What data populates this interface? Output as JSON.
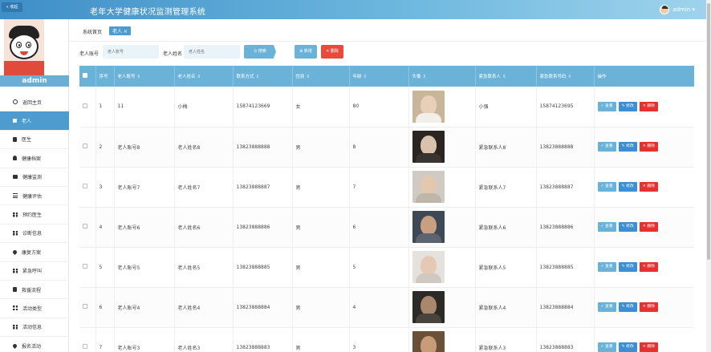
{
  "header": {
    "collapse_label": "« 收起",
    "title": "老年大学健康状况监测管理系统",
    "user": "admin ▾"
  },
  "sidebar": {
    "username": "admin",
    "items": [
      {
        "label": "返回主页",
        "icon": "home-icon"
      },
      {
        "label": "老人",
        "icon": "square-icon",
        "active": true
      },
      {
        "label": "医生",
        "icon": "doc-icon"
      },
      {
        "label": "健康档案",
        "icon": "person-icon"
      },
      {
        "label": "健康监测",
        "icon": "briefcase-icon"
      },
      {
        "label": "健康评估",
        "icon": "list-icon"
      },
      {
        "label": "预约医生",
        "icon": "grid-icon"
      },
      {
        "label": "诊断信息",
        "icon": "grid-icon"
      },
      {
        "label": "康复方案",
        "icon": "pin-icon"
      },
      {
        "label": "紧急呼叫",
        "icon": "grid-icon"
      },
      {
        "label": "救援流程",
        "icon": "doc-icon"
      },
      {
        "label": "活动类型",
        "icon": "grid-icon"
      },
      {
        "label": "活动信息",
        "icon": "grid-icon"
      },
      {
        "label": "报名活动",
        "icon": "pin-icon"
      }
    ]
  },
  "breadcrumb": {
    "home": "系统首页",
    "tag": "老人 ×"
  },
  "search": {
    "account_label": "老人账号",
    "account_placeholder": "老人账号",
    "name_label": "老人姓名",
    "name_placeholder": "老人姓名",
    "search_btn": "⊙ 搜索",
    "add_btn": "⊕ 新增",
    "delete_btn": "✕ 删除"
  },
  "table": {
    "headers": [
      "",
      "序号",
      "老人账号",
      "老人姓名",
      "联系方式",
      "性别",
      "年龄",
      "头像",
      "紧急联系人",
      "紧急联系号码",
      "操作"
    ],
    "ops": {
      "view": "✓ 查看",
      "edit": "✎ 修改",
      "delete": "✕ 删除"
    },
    "rows": [
      {
        "no": "1",
        "account": "11",
        "name": "小梅",
        "phone": "15874123669",
        "gender": "女",
        "age": "80",
        "contact": "小强",
        "contact_phone": "15874123695"
      },
      {
        "no": "2",
        "account": "老人账号8",
        "name": "老人姓名8",
        "phone": "13823888888",
        "gender": "男",
        "age": "8",
        "contact": "紧急联系人8",
        "contact_phone": "13823888888"
      },
      {
        "no": "3",
        "account": "老人账号7",
        "name": "老人姓名7",
        "phone": "13823888887",
        "gender": "男",
        "age": "7",
        "contact": "紧急联系人7",
        "contact_phone": "13823888887"
      },
      {
        "no": "4",
        "account": "老人账号6",
        "name": "老人姓名6",
        "phone": "13823888886",
        "gender": "男",
        "age": "6",
        "contact": "紧急联系人6",
        "contact_phone": "13823888886"
      },
      {
        "no": "5",
        "account": "老人账号5",
        "name": "老人姓名5",
        "phone": "13823888885",
        "gender": "男",
        "age": "5",
        "contact": "紧急联系人5",
        "contact_phone": "13823888885"
      },
      {
        "no": "6",
        "account": "老人账号4",
        "name": "老人姓名4",
        "phone": "13823888884",
        "gender": "男",
        "age": "4",
        "contact": "紧急联系人4",
        "contact_phone": "13823888884"
      },
      {
        "no": "7",
        "account": "老人账号3",
        "name": "老人姓名3",
        "phone": "13823888883",
        "gender": "男",
        "age": "3",
        "contact": "紧急联系人3",
        "contact_phone": "13823888883"
      }
    ]
  },
  "colors": {
    "primary": "#6bb2d9",
    "edit": "#3d8fd1",
    "danger": "#e8302f",
    "active_menu": "#4e9bd0"
  }
}
